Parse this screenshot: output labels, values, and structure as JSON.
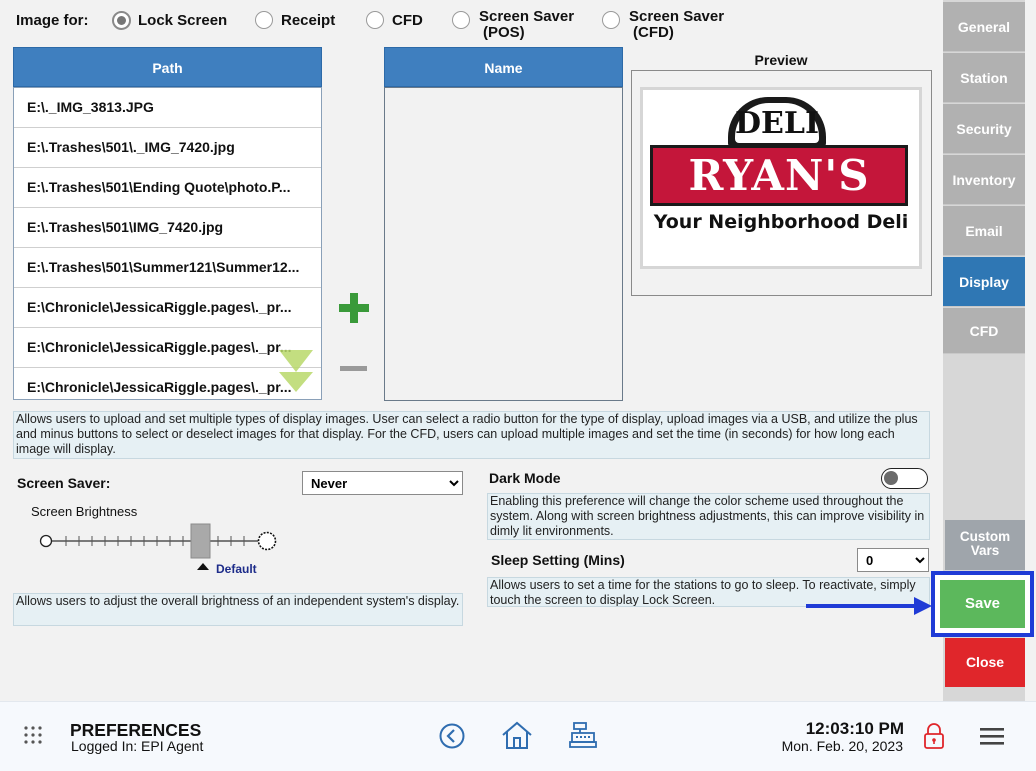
{
  "image_for": {
    "label": "Image for:",
    "options": [
      {
        "line1": "Lock Screen",
        "line2": "",
        "selected": true
      },
      {
        "line1": "Receipt",
        "line2": "",
        "selected": false
      },
      {
        "line1": "CFD",
        "line2": "",
        "selected": false
      },
      {
        "line1": "Screen Saver",
        "line2": "(POS)",
        "selected": false
      },
      {
        "line1": "Screen Saver",
        "line2": "(CFD)",
        "selected": false
      }
    ]
  },
  "path_table": {
    "header": "Path",
    "rows": [
      "E:\\._IMG_3813.JPG",
      "E:\\.Trashes\\501\\._IMG_7420.jpg",
      "E:\\.Trashes\\501\\Ending Quote\\photo.P...",
      "E:\\.Trashes\\501\\IMG_7420.jpg",
      "E:\\.Trashes\\501\\Summer121\\Summer12...",
      "E:\\Chronicle\\JessicaRiggle.pages\\._pr...",
      "E:\\Chronicle\\JessicaRiggle.pages\\._pr...",
      "E:\\Chronicle\\JessicaRiggle.pages\\._pr..."
    ]
  },
  "name_table": {
    "header": "Name"
  },
  "preview": {
    "label": "Preview",
    "logo_top": "DELI",
    "logo_main": "RYAN'S",
    "logo_tagline": "Your Neighborhood Deli"
  },
  "description": "Allows users to upload and set multiple types of display images. User can select a radio button for the type of display, upload images via a USB, and utilize the plus and minus buttons to select or deselect images for that display. For the CFD, users can upload multiple images and set the time (in seconds) for how long each image will display.",
  "screen_saver": {
    "label": "Screen Saver:",
    "value": "Never",
    "brightness_label": "Screen Brightness",
    "default_label": "Default",
    "brightness_level": 0.7,
    "help": "Allows users to adjust the overall brightness of an independent system's display."
  },
  "dark_mode": {
    "label": "Dark Mode",
    "enabled": false,
    "help": "Enabling this preference will change the color scheme used throughout the system. Along with screen brightness adjustments, this can improve visibility in dimly lit environments."
  },
  "sleep": {
    "label": "Sleep Setting (Mins)",
    "value": "0",
    "help": "Allows users to set a time for the stations to go to sleep. To reactivate, simply touch the screen to display Lock Screen."
  },
  "sidebar": {
    "items": [
      "General",
      "Station",
      "Security",
      "Inventory",
      "Email",
      "Display",
      "CFD"
    ],
    "active": "Display",
    "custom_vars": [
      "Custom",
      "Vars"
    ],
    "save": "Save",
    "close": "Close"
  },
  "footer": {
    "title": "PREFERENCES",
    "logged_in": "Logged In:  EPI Agent",
    "time": "12:03:10 PM",
    "date": "Mon. Feb. 20, 2023"
  },
  "colors": {
    "accent": "#3f7fbf",
    "save_green": "#5cb85c",
    "close_red": "#e0262b",
    "highlight_blue": "#1f3bd6",
    "plus_green": "#3a9a3a"
  }
}
